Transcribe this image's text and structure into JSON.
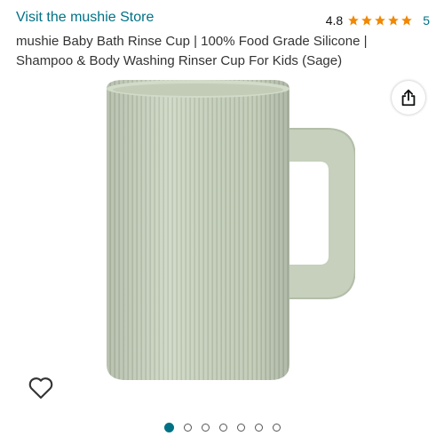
{
  "header": {
    "store_link": "Visit the mushie Store",
    "rating_value": "4.8",
    "rating_stars": 5,
    "rating_count": "5"
  },
  "product": {
    "title": "mushie Baby Bath Rinse Cup | 100% Food Grade Silicone | Shampoo & Body Washing Rinser Cup For Kids (Sage)",
    "image_alt": "Sage green ribbed silicone rinse cup with handle"
  },
  "gallery": {
    "total_images": 7,
    "active_index": 0
  },
  "icons": {
    "share": "share-icon",
    "wishlist": "heart-icon",
    "star": "star-icon"
  },
  "colors": {
    "link": "#007185",
    "star": "#f08804",
    "cup": "#ccd6c2"
  }
}
